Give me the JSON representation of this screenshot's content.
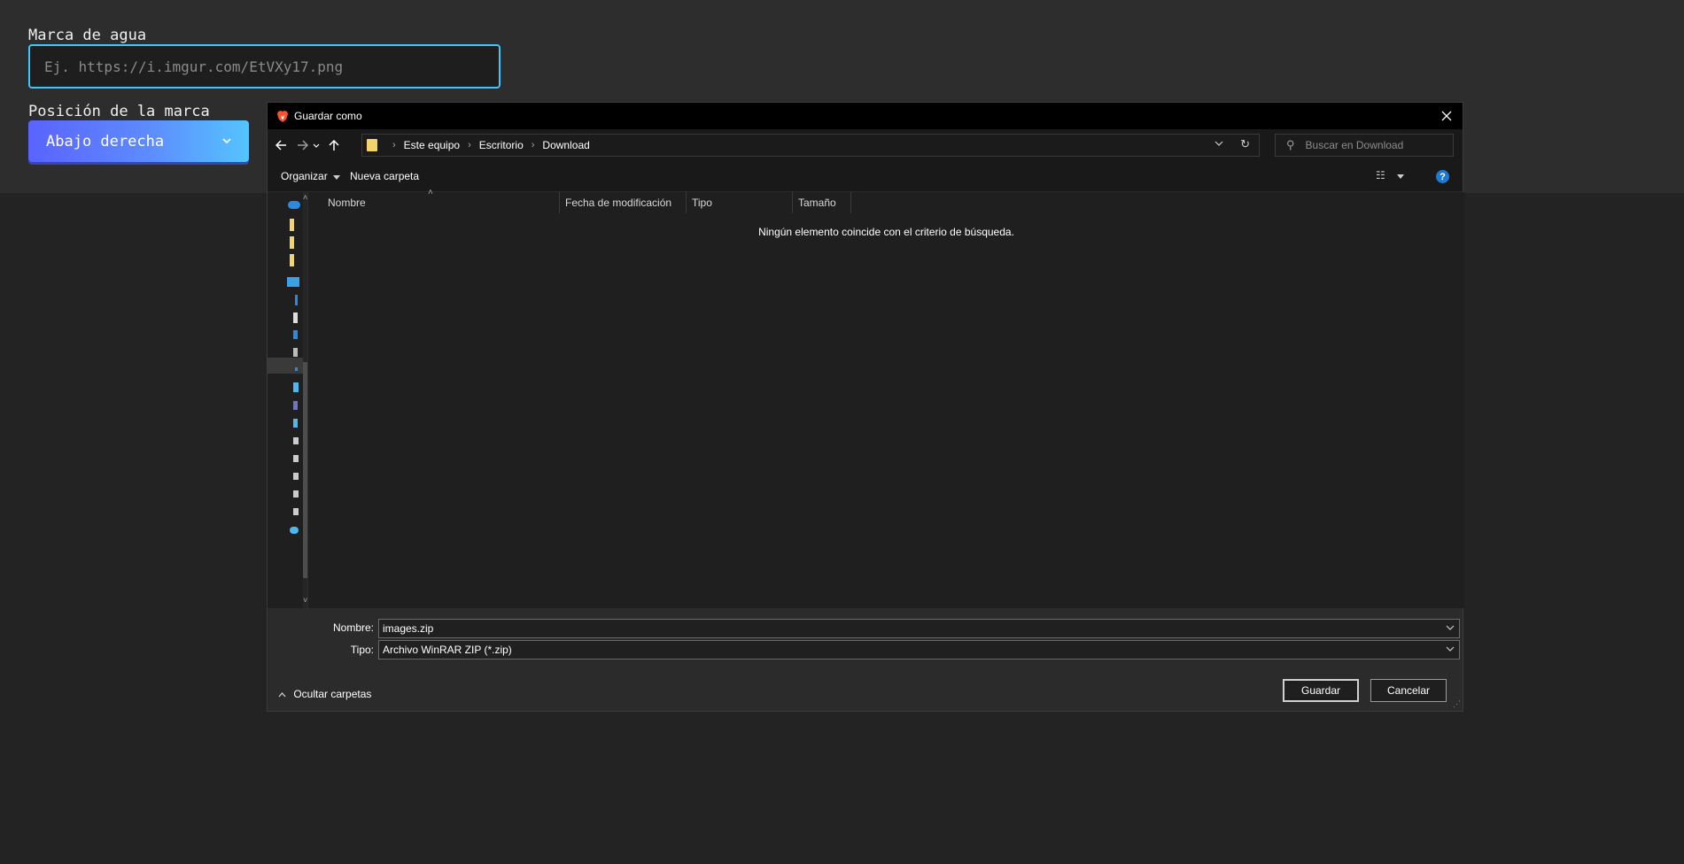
{
  "page": {
    "watermark_label": "Marca de agua",
    "watermark_placeholder": "Ej. https://i.imgur.com/EtVXy17.png",
    "position_label": "Posición de la marca",
    "position_value": "Abajo derecha"
  },
  "dialog": {
    "title": "Guardar como",
    "breadcrumb": [
      "Este equipo",
      "Escritorio",
      "Download"
    ],
    "search_placeholder": "Buscar en Download",
    "toolbar": {
      "organize": "Organizar",
      "new_folder": "Nueva carpeta"
    },
    "columns": [
      "Nombre",
      "Fecha de modificación",
      "Tipo",
      "Tamaño"
    ],
    "empty_message": "Ningún elemento coincide con el criterio de búsqueda.",
    "filename_label": "Nombre:",
    "filename_value": "images.zip",
    "filetype_label": "Tipo:",
    "filetype_value": "Archivo WinRAR ZIP (*.zip)",
    "hide_folders": "Ocultar carpetas",
    "save_button": "Guardar",
    "cancel_button": "Cancelar"
  },
  "colors": {
    "accent_border": "#3ec6ff",
    "select_gradient_start": "#5a63ff",
    "select_gradient_end": "#55c4ff",
    "help_blue": "#1a7bd6"
  }
}
